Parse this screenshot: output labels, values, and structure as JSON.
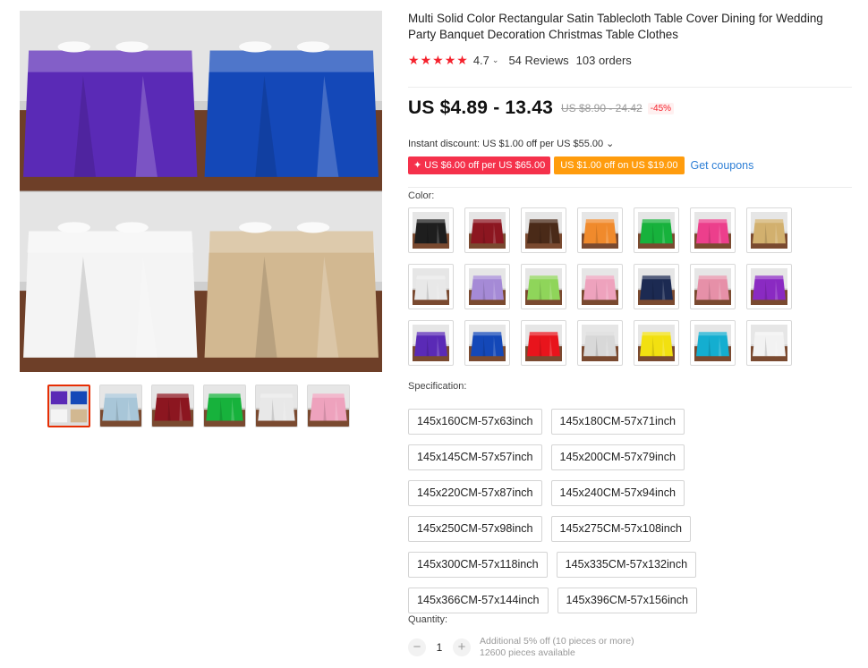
{
  "product": {
    "title": "Multi Solid Color Rectangular Satin Tablecloth Table Cover Dining for Wedding Party Banquet Decoration Christmas Table Clothes",
    "rating": "4.7",
    "rating_chevron": "⌄",
    "reviews": "54 Reviews",
    "orders": "103 orders",
    "stars": 5
  },
  "price": {
    "current": "US $4.89 - 13.43",
    "original": "US $8.90 - 24.42",
    "discount": "-45%",
    "instant_discount": "Instant discount: US $1.00 off per US $55.00 ⌄"
  },
  "coupons": {
    "coupon_a": "✦ US $6.00 off per US $65.00",
    "coupon_b": "US $1.00 off on US $19.00",
    "get_coupons": "Get coupons",
    "coupon_a_color": "#f5314b",
    "coupon_b_color": "#ff9c0d"
  },
  "color_label": "Color:",
  "colors": [
    "#1e1e1e",
    "#8c1620",
    "#4a2a18",
    "#f08a2c",
    "#17b23c",
    "#ec3f8c",
    "#d2b06e",
    "#e8e8e8",
    "#a58ad6",
    "#8fd55a",
    "#eea2bd",
    "#1c2a52",
    "#e690a8",
    "#8a2ac2",
    "#5a2ab6",
    "#1448b8",
    "#e8141c",
    "#d8d8d8",
    "#f2e010",
    "#14aed0",
    "#f2f2f2"
  ],
  "spec_label": "Specification:",
  "specs": [
    [
      "145x160CM-57x63inch",
      "145x180CM-57x71inch"
    ],
    [
      "145x145CM-57x57inch",
      "145x200CM-57x79inch"
    ],
    [
      "145x220CM-57x87inch",
      "145x240CM-57x94inch"
    ],
    [
      "145x250CM-57x98inch",
      "145x275CM-57x108inch"
    ],
    [
      "145x300CM-57x118inch",
      "145x335CM-57x132inch"
    ],
    [
      "145x366CM-57x144inch",
      "145x396CM-57x156inch"
    ]
  ],
  "quantity": {
    "label": "Quantity:",
    "minus": "−",
    "value": "1",
    "plus": "+",
    "note_1": "Additional 5% off (10 pieces or more)",
    "note_2": "12600 pieces available"
  },
  "gallery": {
    "main_quadrants": [
      "#5a2ab6",
      "#1448b8",
      "#f4f4f4",
      "#d2b891"
    ],
    "thumbnails": [
      "multi",
      "#a8c6d8",
      "#8c1620",
      "#17b23c",
      "#e8e8e8",
      "#eea2bd"
    ]
  }
}
